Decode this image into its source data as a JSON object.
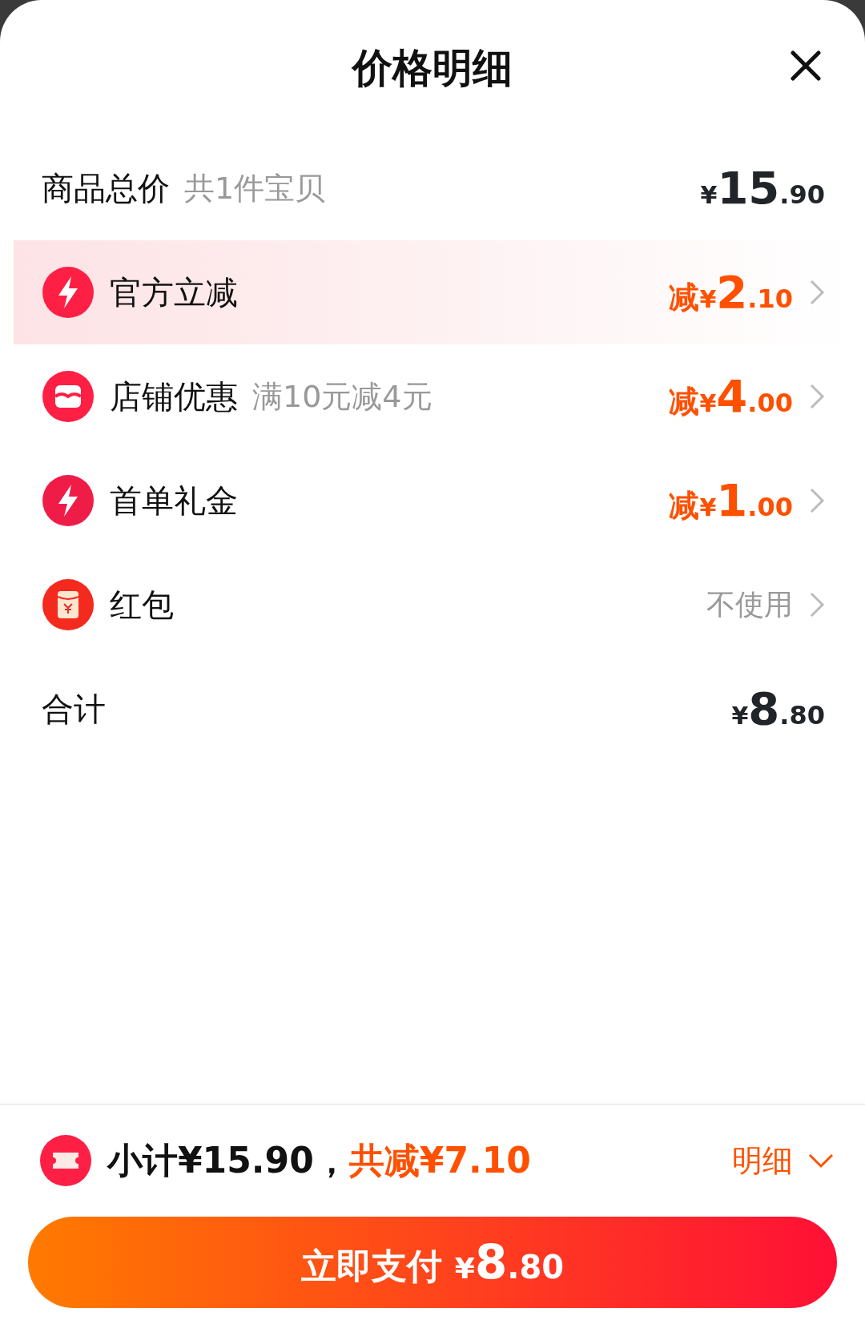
{
  "title": "价格明细",
  "total_price": {
    "label": "商品总价",
    "note": "共1件宝贝",
    "price": {
      "currency": "¥",
      "integer": "15",
      "decimal": ".90"
    }
  },
  "discounts": [
    {
      "label": "官方立减",
      "highlighted": true,
      "kind": "amount",
      "price": {
        "prefix": "减",
        "currency": "¥",
        "integer": "2",
        "decimal": ".10"
      }
    },
    {
      "label": "店铺优惠",
      "note": "满10元减4元",
      "highlighted": false,
      "kind": "amount",
      "price": {
        "prefix": "减",
        "currency": "¥",
        "integer": "4",
        "decimal": ".00"
      }
    },
    {
      "label": "首单礼金",
      "highlighted": false,
      "kind": "amount",
      "price": {
        "prefix": "减",
        "currency": "¥",
        "integer": "1",
        "decimal": ".00"
      }
    },
    {
      "label": "红包",
      "highlighted": false,
      "kind": "option",
      "value": "不使用"
    }
  ],
  "sum": {
    "label": "合计",
    "price": {
      "currency": "¥",
      "integer": "8",
      "decimal": ".80"
    }
  },
  "footer": {
    "subtotal": "小计¥15.90，",
    "saved": "共减¥7.10",
    "details": "明细",
    "pay_button": {
      "label": "立即支付",
      "currency": "¥",
      "integer": "8",
      "decimal": ".80"
    }
  }
}
